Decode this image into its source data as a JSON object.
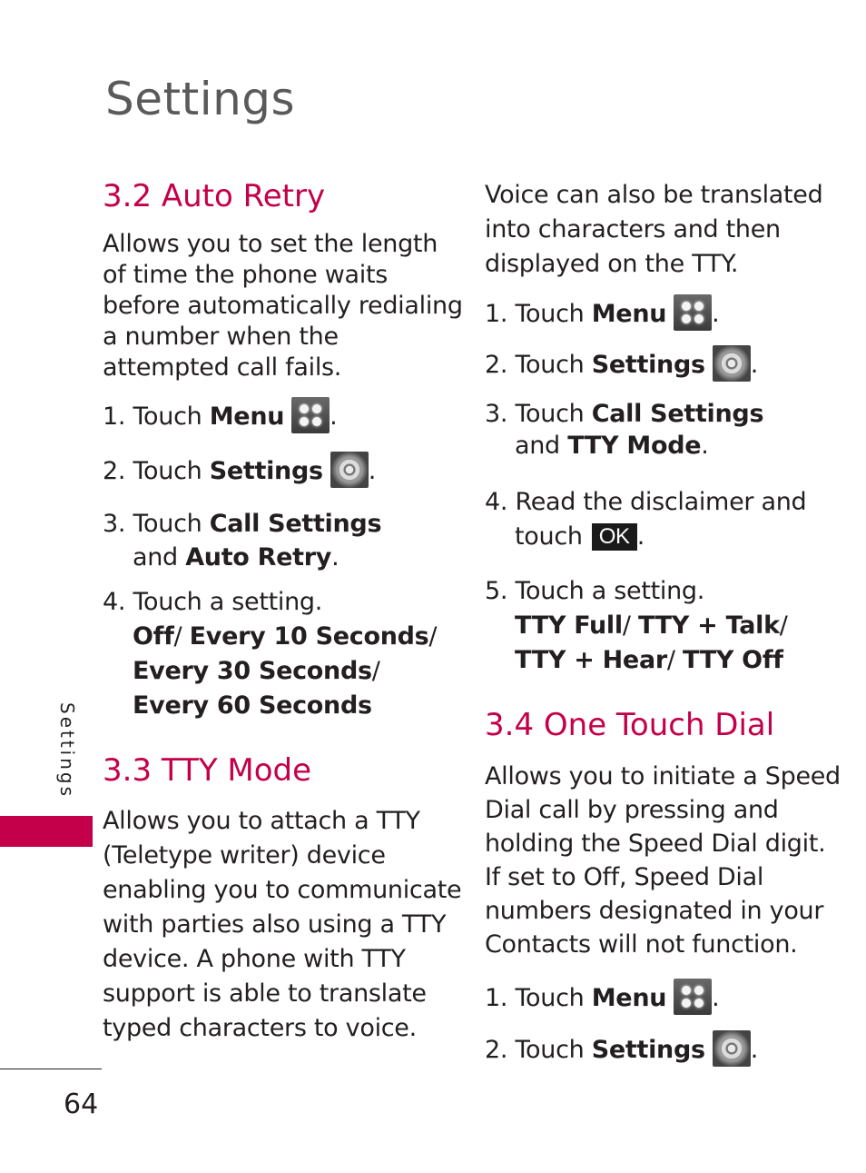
{
  "page_title": "Settings",
  "side_tab_label": "Settings",
  "page_number": "64",
  "accent_color": "#c4004a",
  "sections": {
    "auto_retry": {
      "heading": "3.2 Auto Retry",
      "desc": [
        "Allows you to set the length",
        "of time the phone waits",
        "before automatically redialing",
        "a number when the",
        "attempted call fails."
      ],
      "s1_pre": "1. Touch ",
      "s1_bold": "Menu",
      "s1_post": ".",
      "s2_pre": "2. Touch ",
      "s2_bold": "Settings",
      "s2_post": ".",
      "s3_pre": "3. Touch ",
      "s3_bold": "Call Settings",
      "s3_mid": "and ",
      "s3_bold2": "Auto Retry",
      "s3_post": ".",
      "s4_text": "4. Touch a setting.",
      "options": [
        "Off",
        "Every 10 Seconds",
        "Every 30 Seconds",
        "Every 60 Seconds"
      ],
      "sep": "/"
    },
    "tty_mode": {
      "heading": "3.3 TTY Mode",
      "desc": [
        "Allows you to attach a TTY",
        "(Teletype writer) device",
        "enabling you to communicate",
        "with parties also using a TTY",
        "device. A phone with TTY",
        "support is able to translate",
        "typed characters to voice."
      ],
      "desc2": [
        "Voice can also be translated",
        "into characters and then",
        "displayed on the TTY."
      ],
      "s1_pre": "1. Touch ",
      "s1_bold": "Menu",
      "s1_post": ".",
      "s2_pre": "2. Touch ",
      "s2_bold": "Settings",
      "s2_post": ".",
      "s3_pre": "3. Touch ",
      "s3_bold": "Call Settings",
      "s3_mid": "and ",
      "s3_bold2": "TTY Mode",
      "s3_post": ".",
      "s4_text": "4. Read the disclaimer and",
      "s4_text2": "touch",
      "ok_label": "OK",
      "s4_post": ".",
      "s5_text": "5. Touch a setting.",
      "options": [
        "TTY Full",
        "TTY + Talk",
        "TTY + Hear",
        "TTY Off"
      ],
      "sep": "/"
    },
    "one_touch_dial": {
      "heading": "3.4 One Touch Dial",
      "desc": [
        "Allows you to initiate a Speed",
        "Dial call by pressing and",
        "holding the Speed Dial digit.",
        "If set to Off, Speed Dial",
        "numbers designated in your",
        "Contacts will not function."
      ],
      "s1_pre": "1. Touch ",
      "s1_bold": "Menu",
      "s1_post": ".",
      "s2_pre": "2. Touch ",
      "s2_bold": "Settings",
      "s2_post": "."
    }
  }
}
